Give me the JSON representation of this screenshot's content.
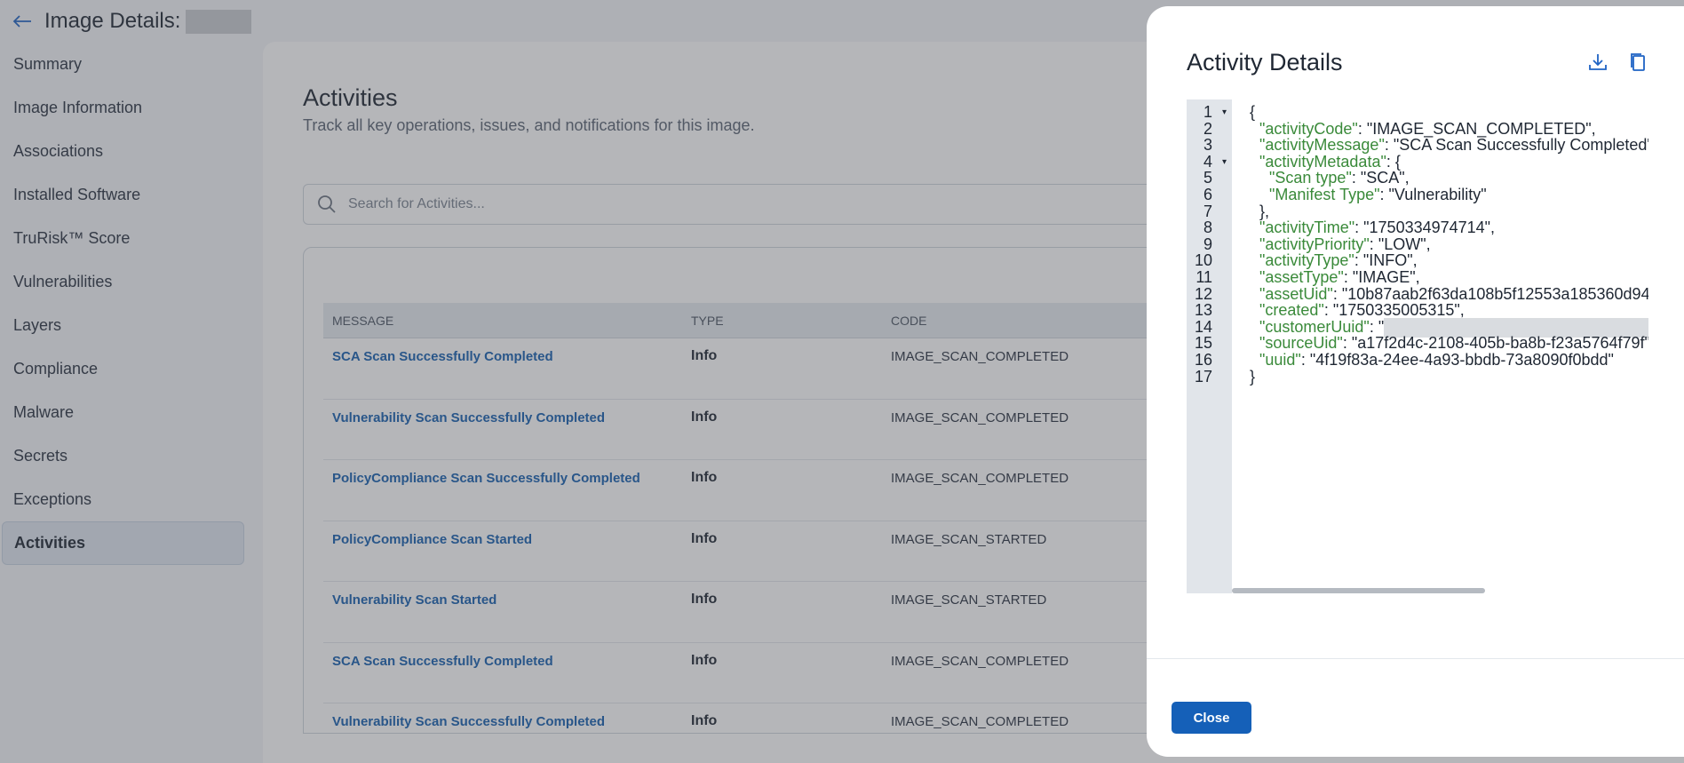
{
  "header": {
    "title": "Image Details:"
  },
  "sidebar": {
    "items": [
      {
        "label": "Summary"
      },
      {
        "label": "Image Information"
      },
      {
        "label": "Associations"
      },
      {
        "label": "Installed Software"
      },
      {
        "label": "TruRisk™ Score"
      },
      {
        "label": "Vulnerabilities"
      },
      {
        "label": "Layers"
      },
      {
        "label": "Compliance"
      },
      {
        "label": "Malware"
      },
      {
        "label": "Secrets"
      },
      {
        "label": "Exceptions"
      },
      {
        "label": "Activities",
        "active": true
      }
    ]
  },
  "main": {
    "title": "Activities",
    "subtitle": "Track all key operations, issues, and notifications for this image.",
    "search": {
      "placeholder": "Search for Activities..."
    },
    "table": {
      "columns": [
        "MESSAGE",
        "TYPE",
        "CODE"
      ],
      "rows": [
        {
          "message": "SCA Scan Successfully Completed",
          "type": "Info",
          "code": "IMAGE_SCAN_COMPLETED"
        },
        {
          "message": "Vulnerability Scan Successfully Completed",
          "type": "Info",
          "code": "IMAGE_SCAN_COMPLETED"
        },
        {
          "message": "PolicyCompliance Scan Successfully Completed",
          "type": "Info",
          "code": "IMAGE_SCAN_COMPLETED"
        },
        {
          "message": "PolicyCompliance Scan Started",
          "type": "Info",
          "code": "IMAGE_SCAN_STARTED"
        },
        {
          "message": "Vulnerability Scan Started",
          "type": "Info",
          "code": "IMAGE_SCAN_STARTED"
        },
        {
          "message": "SCA Scan Successfully Completed",
          "type": "Info",
          "code": "IMAGE_SCAN_COMPLETED"
        },
        {
          "message": "Vulnerability Scan Successfully Completed",
          "type": "Info",
          "code": "IMAGE_SCAN_COMPLETED"
        }
      ]
    }
  },
  "drawer": {
    "title": "Activity Details",
    "download_icon": "download-icon",
    "copy_icon": "copy-icon",
    "close_label": "Close",
    "json_lines": [
      {
        "n": "1",
        "fold": true,
        "indent": "",
        "key": "",
        "sep": "",
        "value": "{"
      },
      {
        "n": "2",
        "indent": "  ",
        "key": "\"activityCode\"",
        "sep": ": ",
        "value": "\"IMAGE_SCAN_COMPLETED\","
      },
      {
        "n": "3",
        "indent": "  ",
        "key": "\"activityMessage\"",
        "sep": ": ",
        "value": "\"SCA Scan Successfully Completed\""
      },
      {
        "n": "4",
        "fold": true,
        "indent": "  ",
        "key": "\"activityMetadata\"",
        "sep": ": ",
        "value": "{"
      },
      {
        "n": "5",
        "indent": "    ",
        "key": "\"Scan type\"",
        "sep": ": ",
        "value": "\"SCA\","
      },
      {
        "n": "6",
        "indent": "    ",
        "key": "\"Manifest Type\"",
        "sep": ": ",
        "value": "\"Vulnerability\""
      },
      {
        "n": "7",
        "indent": "  ",
        "key": "",
        "sep": "",
        "value": "},"
      },
      {
        "n": "8",
        "indent": "  ",
        "key": "\"activityTime\"",
        "sep": ": ",
        "value": "\"1750334974714\","
      },
      {
        "n": "9",
        "indent": "  ",
        "key": "\"activityPriority\"",
        "sep": ": ",
        "value": "\"LOW\","
      },
      {
        "n": "10",
        "indent": "  ",
        "key": "\"activityType\"",
        "sep": ": ",
        "value": "\"INFO\","
      },
      {
        "n": "11",
        "indent": "  ",
        "key": "\"assetType\"",
        "sep": ": ",
        "value": "\"IMAGE\","
      },
      {
        "n": "12",
        "indent": "  ",
        "key": "\"assetUid\"",
        "sep": ": ",
        "value": "\"10b87aab2f63da108b5f12553a185360d94"
      },
      {
        "n": "13",
        "indent": "  ",
        "key": "\"created\"",
        "sep": ": ",
        "value": "\"1750335005315\","
      },
      {
        "n": "14",
        "indent": "  ",
        "key": "\"customerUuid\"",
        "sep": ": ",
        "value": "\"",
        "masked": true
      },
      {
        "n": "15",
        "indent": "  ",
        "key": "\"sourceUid\"",
        "sep": ": ",
        "value": "\"a17f2d4c-2108-405b-ba8b-f23a5764f79f\""
      },
      {
        "n": "16",
        "indent": "  ",
        "key": "\"uuid\"",
        "sep": ": ",
        "value": "\"4f19f83a-24ee-4a93-bbdb-73a8090f0bdd\""
      },
      {
        "n": "17",
        "indent": "",
        "key": "",
        "sep": "",
        "value": "}"
      }
    ]
  },
  "colors": {
    "accent": "#1560b8",
    "link": "#1760b0",
    "json_key": "#3a8a3a"
  }
}
